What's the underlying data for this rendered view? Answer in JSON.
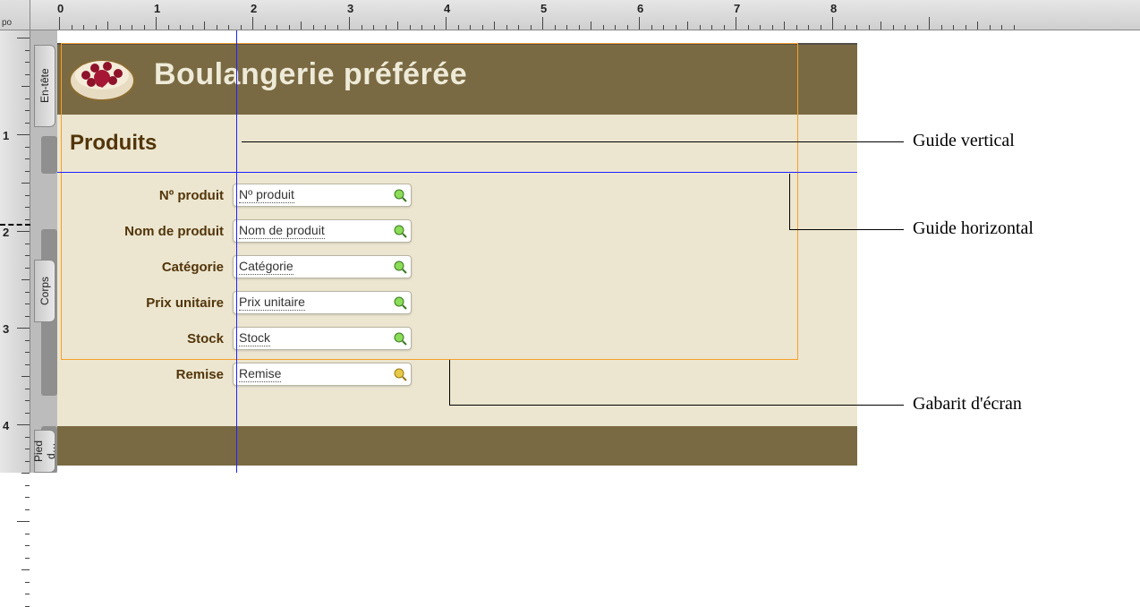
{
  "ruler_unit": "po",
  "h_ticks": [
    "0",
    "1",
    "2",
    "3",
    "4",
    "5",
    "6",
    "7",
    "8"
  ],
  "v_ticks": [
    "1",
    "2",
    "3",
    "4"
  ],
  "part_tabs": {
    "header": "En-tête",
    "body": "Corps",
    "footer": "Pied d…"
  },
  "header": {
    "title": "Boulangerie préférée"
  },
  "section_title": "Produits",
  "fields": [
    {
      "label": "Nº produit",
      "placeholder": "Nº produit"
    },
    {
      "label": "Nom de produit",
      "placeholder": "Nom de produit"
    },
    {
      "label": "Catégorie",
      "placeholder": "Catégorie"
    },
    {
      "label": "Prix unitaire",
      "placeholder": "Prix unitaire"
    },
    {
      "label": "Stock",
      "placeholder": "Stock"
    },
    {
      "label": "Remise",
      "placeholder": "Remise"
    }
  ],
  "callouts": {
    "guide_v": "Guide vertical",
    "guide_h": "Guide horizontal",
    "gabarit": "Gabarit d'écran"
  }
}
